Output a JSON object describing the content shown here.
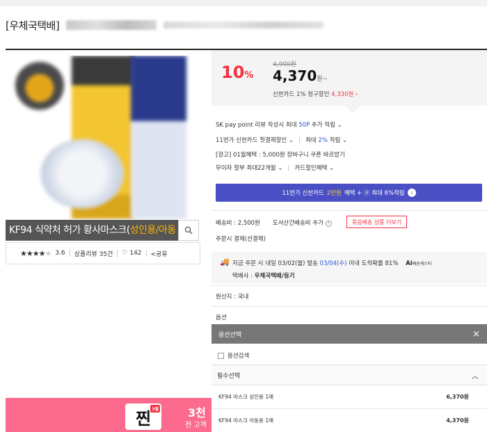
{
  "header": {
    "title_tag": "[우체국택배]"
  },
  "product": {
    "caption_main": "KF94 식약처 허가 황사마스크(",
    "caption_highlight": "성인용/아동",
    "rating": "3.6",
    "review_label": "상품리뷰 35건",
    "like_count": "142",
    "share_label": "공유",
    "stars_value": 3.5,
    "stars_max": 5
  },
  "price": {
    "discount": "10",
    "discount_unit": "%",
    "original": "4,900원",
    "sale": "4,370",
    "sale_unit": "원~",
    "card_discount_prefix": "신한카드 1% 청구할인",
    "card_discount_price": "4,330원",
    "card_discount_arrow": "›"
  },
  "benefits": {
    "line1_a": "SK pay point 리뷰 작성시 최대",
    "line1_b": "50P",
    "line1_c": "추가 적립",
    "line2_a": "11번가 신한카드 첫결제할인",
    "line2_b": "최대",
    "line2_c": "2%",
    "line2_d": "적립",
    "line3": "[광고] 01월혜택 : 5,000원 장바구니 쿠폰 바르받기",
    "line4_a": "무이자 할부 최대22개월",
    "line4_b": "카드할인혜택",
    "caret": "⌄",
    "banner_a": "11번가 신한카드",
    "banner_b": "2만원",
    "banner_c": "혜택 + ⓟ 최대 6%적립",
    "banner_arrow": "›"
  },
  "shipping": {
    "fee": "배송비 : 2,500원",
    "extra": "도서산간배송비 추가",
    "help": "?",
    "more_button": "묶음배송 상품 더보기",
    "payment": "주문시 결제(선결제)",
    "delivery_a": "지금 주문 시 내일 03/02(월) 발송",
    "delivery_b": "03/04(수)",
    "delivery_c": "이내 도착확률 81%",
    "ai_prefix": "Ai",
    "ai_label": "배송캐스터",
    "carrier_label": "택배사 :",
    "carrier_value": "우체국택배/등기"
  },
  "origin": "원산지 : 국내",
  "options": {
    "section_label": "옵션",
    "header": "옵션선택",
    "close": "×",
    "search_label": "옵션검색",
    "required": "필수선택",
    "collapse": "︿",
    "items": [
      {
        "name": "KF94 마스크 성인용 1매",
        "price": "6,370원"
      },
      {
        "name": "KF94 마스크 아동용 1매",
        "price": "4,370원"
      }
    ]
  },
  "banner": {
    "zzim": "찐",
    "month": "3월",
    "line1": "3천",
    "line2": "전 고객"
  },
  "colors": {
    "accent_red": "#f43142",
    "accent_blue": "#2b57d6",
    "banner_purple": "#4a4fc4",
    "banner_pink": "#fc6a8e"
  }
}
